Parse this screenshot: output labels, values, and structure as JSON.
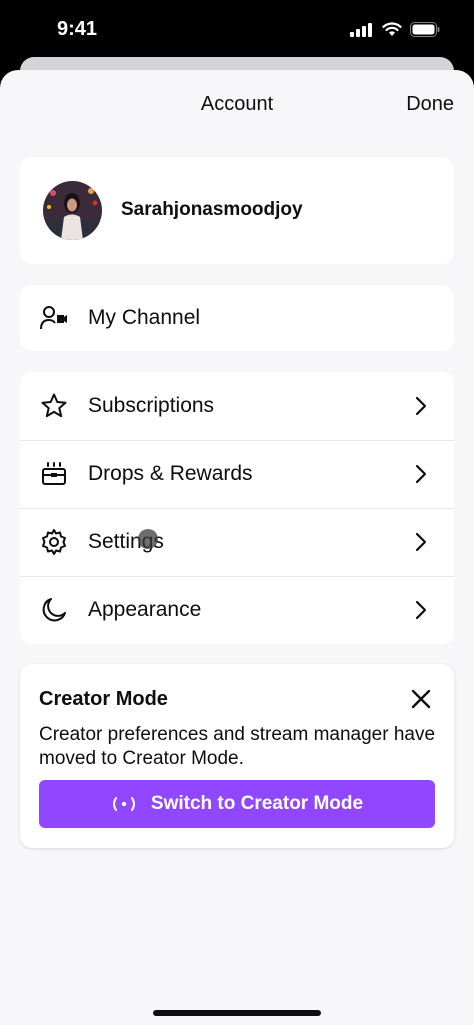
{
  "status_bar": {
    "time": "9:41"
  },
  "header": {
    "title": "Account",
    "done_label": "Done"
  },
  "profile": {
    "username": "Sarahjonasmoodjoy"
  },
  "channel": {
    "label": "My Channel",
    "icon": "user-video-icon"
  },
  "menu": {
    "items": [
      {
        "label": "Subscriptions",
        "icon": "star-icon"
      },
      {
        "label": "Drops & Rewards",
        "icon": "gift-box-icon"
      },
      {
        "label": "Settings",
        "icon": "gear-icon"
      },
      {
        "label": "Appearance",
        "icon": "moon-icon"
      }
    ]
  },
  "creator_mode": {
    "title": "Creator Mode",
    "description": "Creator preferences and stream manager have moved to Creator Mode.",
    "button_label": "Switch to Creator Mode"
  },
  "colors": {
    "accent": "#9147ff",
    "background": "#f7f6f8",
    "card": "#ffffff",
    "text": "#0e0e10"
  }
}
